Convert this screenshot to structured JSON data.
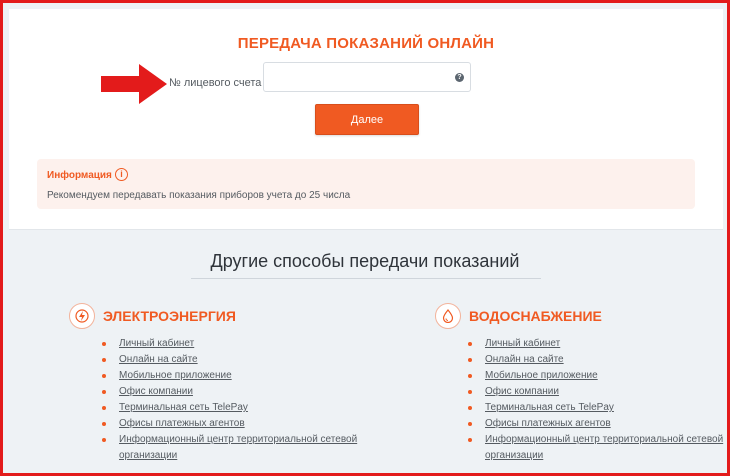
{
  "form": {
    "title": "ПЕРЕДАЧА ПОКАЗАНИЙ ОНЛАЙН",
    "account_label": "№ лицевого счета",
    "account_value": "",
    "account_placeholder": "",
    "help_glyph": "?",
    "next_label": "Далее"
  },
  "info": {
    "title": "Информация",
    "icon_glyph": "i",
    "text": "Рекомендуем передавать показания приборов учета до 25 числа"
  },
  "methods": {
    "title": "Другие способы передачи показаний",
    "electricity": {
      "title": "ЭЛЕКТРОЭНЕРГИЯ",
      "icon": "lightning-icon",
      "links": [
        "Личный кабинет",
        "Онлайн на сайте",
        "Мобильное приложение",
        "Офис компании",
        "Терминальная сеть TelePay",
        "Офисы платежных агентов",
        "Информационный центр территориальной сетевой организации"
      ]
    },
    "water": {
      "title": "ВОДОСНАБЖЕНИЕ",
      "icon": "water-drop-icon",
      "links": [
        "Личный кабинет",
        "Онлайн на сайте",
        "Мобильное приложение",
        "Офис компании",
        "Терминальная сеть TelePay",
        "Офисы платежных агентов",
        "Информационный центр территориальной сетевой организации"
      ]
    }
  },
  "colors": {
    "accent": "#f05a22",
    "frame": "#e31b1b",
    "annotation_arrow": "#e31b1b"
  }
}
